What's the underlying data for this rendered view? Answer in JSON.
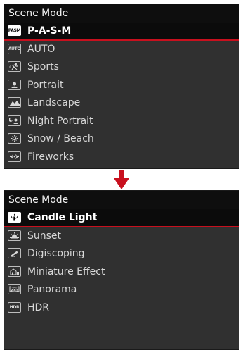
{
  "screen_1": {
    "title": "Scene Mode",
    "items": [
      {
        "label": "P-A-S-M",
        "icon": "pasm-icon",
        "icon_text": "PASM",
        "selected": true
      },
      {
        "label": "AUTO",
        "icon": "auto-icon",
        "icon_text": "AUTO",
        "selected": false
      },
      {
        "label": "Sports",
        "icon": "sports-icon",
        "selected": false
      },
      {
        "label": "Portrait",
        "icon": "portrait-icon",
        "selected": false
      },
      {
        "label": "Landscape",
        "icon": "landscape-icon",
        "selected": false
      },
      {
        "label": "Night Portrait",
        "icon": "night-portrait-icon",
        "selected": false
      },
      {
        "label": "Snow / Beach",
        "icon": "snow-beach-icon",
        "selected": false
      },
      {
        "label": "Fireworks",
        "icon": "fireworks-icon",
        "selected": false
      }
    ]
  },
  "screen_2": {
    "title": "Scene Mode",
    "items": [
      {
        "label": "Candle Light",
        "icon": "candle-light-icon",
        "selected": true
      },
      {
        "label": "Sunset",
        "icon": "sunset-icon",
        "selected": false
      },
      {
        "label": "Digiscoping",
        "icon": "digiscoping-icon",
        "selected": false
      },
      {
        "label": "Miniature Effect",
        "icon": "miniature-effect-icon",
        "selected": false
      },
      {
        "label": "Panorama",
        "icon": "panorama-icon",
        "selected": false
      },
      {
        "label": "HDR",
        "icon": "hdr-icon",
        "icon_text": "HDR",
        "selected": false
      }
    ]
  },
  "colors": {
    "accent": "#c8101e",
    "screen_background": "#303030",
    "title_background": "#0e0e0e",
    "selected_background": "#0b0b0b",
    "text": "#d8d8d8"
  }
}
